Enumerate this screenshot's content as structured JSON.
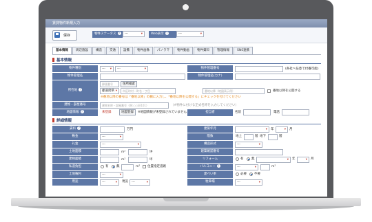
{
  "window": {
    "title": "賃貸物件新規入力"
  },
  "toolbar": {
    "save_label": "保存",
    "status_label": "物件ステータス",
    "status_value": "---",
    "web_label": "Web表示",
    "web_value": "---"
  },
  "tabs": [
    "基本情報",
    "周辺施設",
    "構造",
    "交通",
    "設備",
    "物件画像",
    "パノラマ",
    "物件動画",
    "物件資料",
    "管理情報",
    "SNS連携"
  ],
  "basic": {
    "section_title": "基本情報",
    "type_label": "物件種別",
    "type_value1": "---",
    "type_value2": "---",
    "mgmt_no_label": "物件管理番号",
    "mgmt_no_note": "(各社へ任意で付番可能)",
    "name_label": "物件管理名",
    "name_kana_label": "物件管理名(カナ)",
    "address_label": "所在地",
    "zip_placeholder": "郵便番号",
    "zip_search": "住所検索",
    "pref_value": "都道府県",
    "city_placeholder": "市区町村・町名・丁目",
    "street_placeholder": "番地以降（地図表示用）",
    "address_public": "番地以降を公開する",
    "address_note": "※番地以降の番号は「番地以降」の欄に入力し、「番地以降を公開する」にチェックを付けてください",
    "building_label": "建物・部屋番号",
    "building_placeholder": "建物名称・部屋番号（例:○○荘101）",
    "building_placeholder2": "（※物件に付ける正式名称を入力してください）",
    "geo_label": "地図情報",
    "geo_status": "未登録",
    "geo_button": "地図登録",
    "geo_note": "※地図情報が未登録されていません",
    "manager_label": "担当者",
    "manager_name": "名前",
    "manager_phone": "電話"
  },
  "detail": {
    "section_title": "詳細情報",
    "rent_label": "賃料",
    "rent_unit": "万円",
    "deposit_label": "敷金",
    "deposit_value": "---",
    "key_money_label": "礼金",
    "key_money_value": "---",
    "land_area_label": "土地面積",
    "area_unit": "m²",
    "tsubo_unit": "坪",
    "building_area_label": "建物面積",
    "private_road_label": "私道負担",
    "private_road_options": [
      "有",
      "無"
    ],
    "position_label": "位置指定道路",
    "land_rights_label": "土地権利",
    "land_rights_value": "---",
    "zoning_label": "用途",
    "zoning_value": "---",
    "current_label": "現況",
    "current_value": "---",
    "built_label": "建築年月",
    "built_year": "年",
    "built_month": "月",
    "floors_label": "階数",
    "floors_above": "地上",
    "floors_unit": "階",
    "floors_below": "地下",
    "structure_label": "構造形式",
    "structure_value": "---",
    "confirm_label": "建築確認番号",
    "reform_label": "リフォーム",
    "reform_options": [
      "有",
      "無"
    ],
    "reform_year": "年",
    "reform_month": "月",
    "balcony_label": "バルコニー",
    "balcony_value": "---",
    "building_coverage_label": "建ぺい率",
    "building_coverage_options": [
      "必要",
      "不要"
    ],
    "parking_label": "駐車場",
    "parking_value": "---"
  }
}
